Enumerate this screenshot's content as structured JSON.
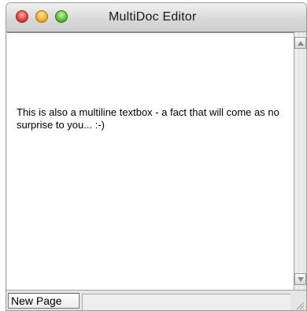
{
  "window": {
    "title": "MultiDoc Editor"
  },
  "titlebar": {
    "buttons": [
      "close",
      "minimize",
      "zoom"
    ]
  },
  "editor": {
    "text": "This is also a multiline textbox - a fact that will come as no surprise to you... :-)"
  },
  "bottom_bar": {
    "new_page_label": "New Page",
    "status_text": ""
  },
  "colors": {
    "close": "#e0443a",
    "minimize": "#f5b12b",
    "zoom": "#5fc23a"
  },
  "icons": {
    "scroll_up": "triangle-up",
    "scroll_down": "triangle-down",
    "resize": "diagonal-grip"
  }
}
